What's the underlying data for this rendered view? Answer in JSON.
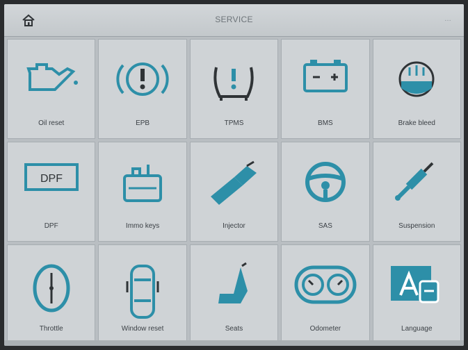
{
  "header": {
    "title": "SERVICE",
    "corner": "…"
  },
  "tiles": [
    {
      "label": "Oil reset",
      "icon": "oil-can-icon"
    },
    {
      "label": "EPB",
      "icon": "brake-warning-icon"
    },
    {
      "label": "TPMS",
      "icon": "tire-pressure-icon"
    },
    {
      "label": "BMS",
      "icon": "battery-icon"
    },
    {
      "label": "Brake bleed",
      "icon": "brake-bleed-icon"
    },
    {
      "label": "DPF",
      "icon": "dpf-icon"
    },
    {
      "label": "Immo keys",
      "icon": "immobilizer-icon"
    },
    {
      "label": "Injector",
      "icon": "injector-icon"
    },
    {
      "label": "SAS",
      "icon": "steering-wheel-icon"
    },
    {
      "label": "Suspension",
      "icon": "suspension-icon"
    },
    {
      "label": "Throttle",
      "icon": "throttle-icon"
    },
    {
      "label": "Window reset",
      "icon": "car-top-view-icon"
    },
    {
      "label": "Seats",
      "icon": "seat-icon"
    },
    {
      "label": "Odometer",
      "icon": "odometer-icon"
    },
    {
      "label": "Language",
      "icon": "language-icon"
    }
  ],
  "colors": {
    "icon": "#2d8fa8",
    "outline": "#2f3336",
    "tile": "#cfd3d6"
  }
}
